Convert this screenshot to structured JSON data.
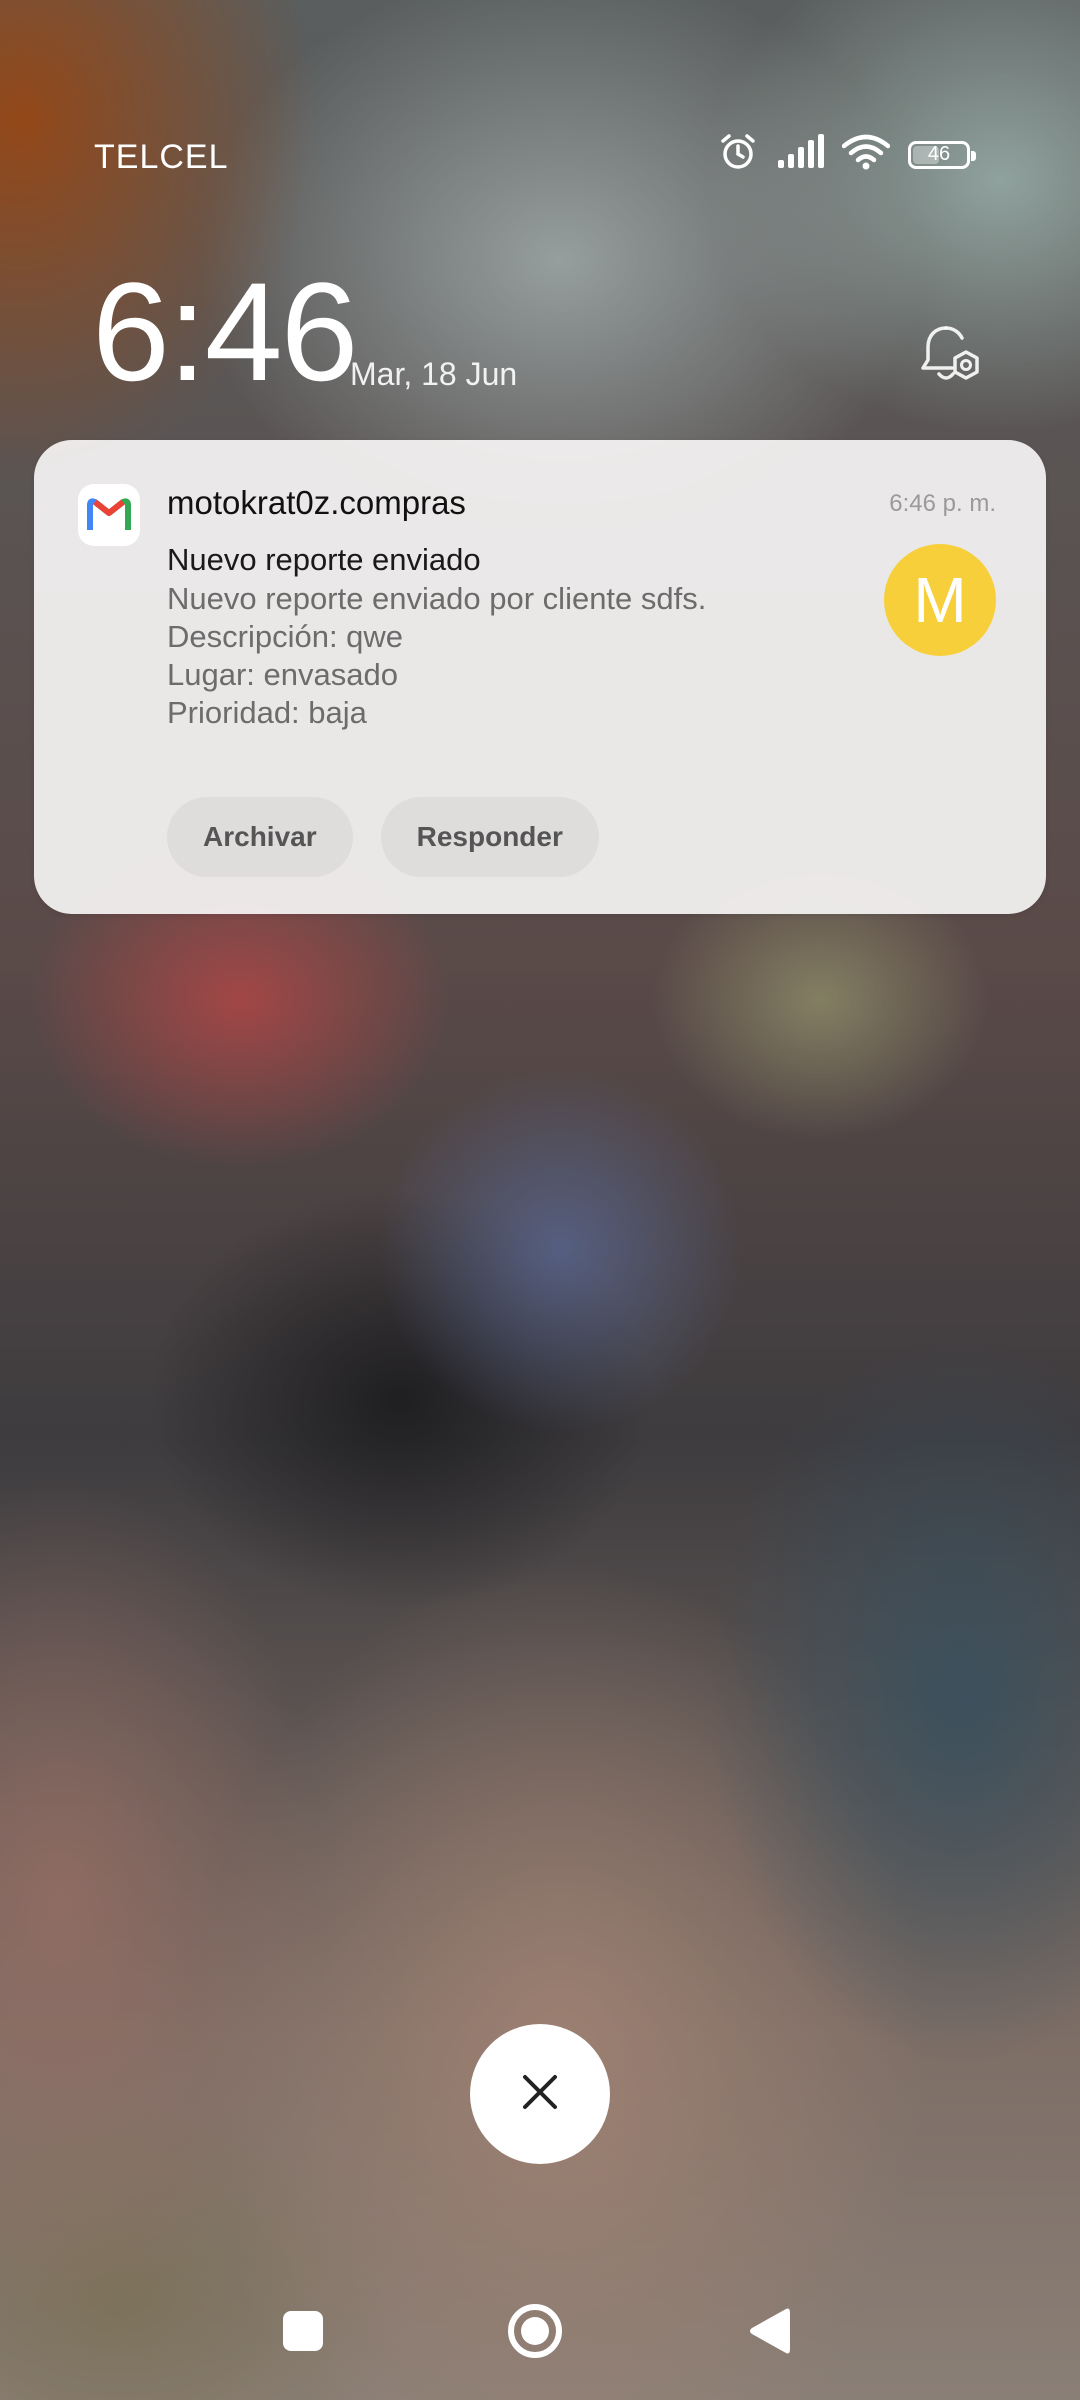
{
  "status_bar": {
    "carrier": "TELCEL",
    "battery_level": "46",
    "icons": [
      "alarm-icon",
      "signal-icon",
      "wifi-icon",
      "battery-icon"
    ]
  },
  "lock_screen": {
    "time": "6:46",
    "date": "Mar, 18 Jun"
  },
  "notification": {
    "app_icon": "gmail-icon",
    "sender": "motokrat0z.compras",
    "time": "6:46 p. m.",
    "avatar_letter": "M",
    "avatar_color": "#f7cf3b",
    "subject": "Nuevo reporte enviado",
    "body_lines": [
      "Nuevo reporte enviado por cliente sdfs.",
      "Descripción: qwe",
      "Lugar: envasado",
      "Prioridad: baja"
    ],
    "actions": [
      {
        "label": "Archivar"
      },
      {
        "label": "Responder"
      }
    ]
  },
  "dismiss": {
    "icon": "close-icon"
  },
  "nav_bar": {
    "icons": [
      "recents-icon",
      "home-icon",
      "back-icon"
    ]
  }
}
